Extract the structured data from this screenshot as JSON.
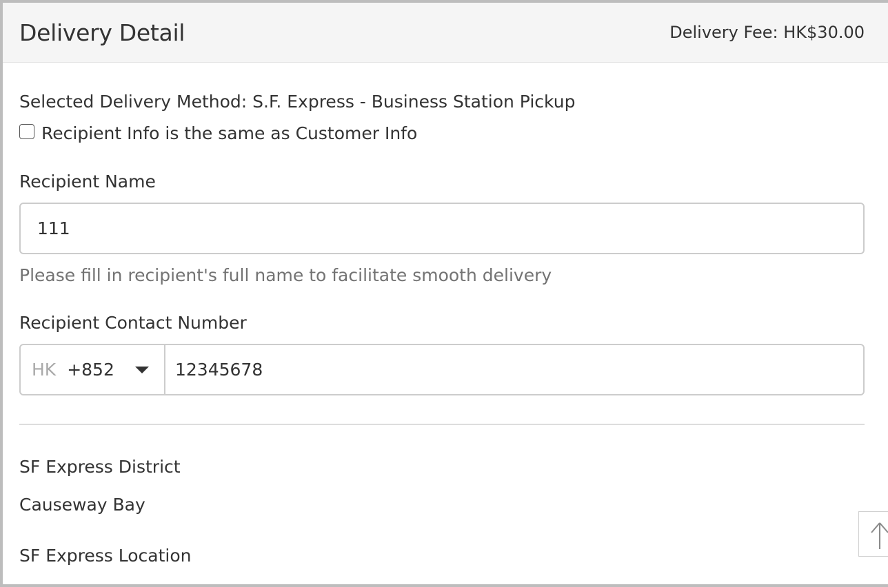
{
  "header": {
    "title": "Delivery Detail",
    "delivery_fee": "Delivery Fee: HK$30.00"
  },
  "delivery": {
    "selected_method": "Selected Delivery Method: S.F. Express - Business Station Pickup",
    "same_as_customer_label": "Recipient Info is the same as Customer Info",
    "same_as_customer_checked": false
  },
  "recipient_name": {
    "label": "Recipient Name",
    "value": "111",
    "help": "Please fill in recipient's full name to facilitate smooth delivery"
  },
  "recipient_contact": {
    "label": "Recipient Contact Number",
    "country": "HK",
    "dial_code": "+852",
    "value": "12345678"
  },
  "sf_express": {
    "district_label": "SF Express District",
    "district_value": "Causeway Bay",
    "location_label": "SF Express Location"
  },
  "icons": {
    "dropdown": "caret-down-icon",
    "scroll_top": "arrow-up-icon"
  }
}
